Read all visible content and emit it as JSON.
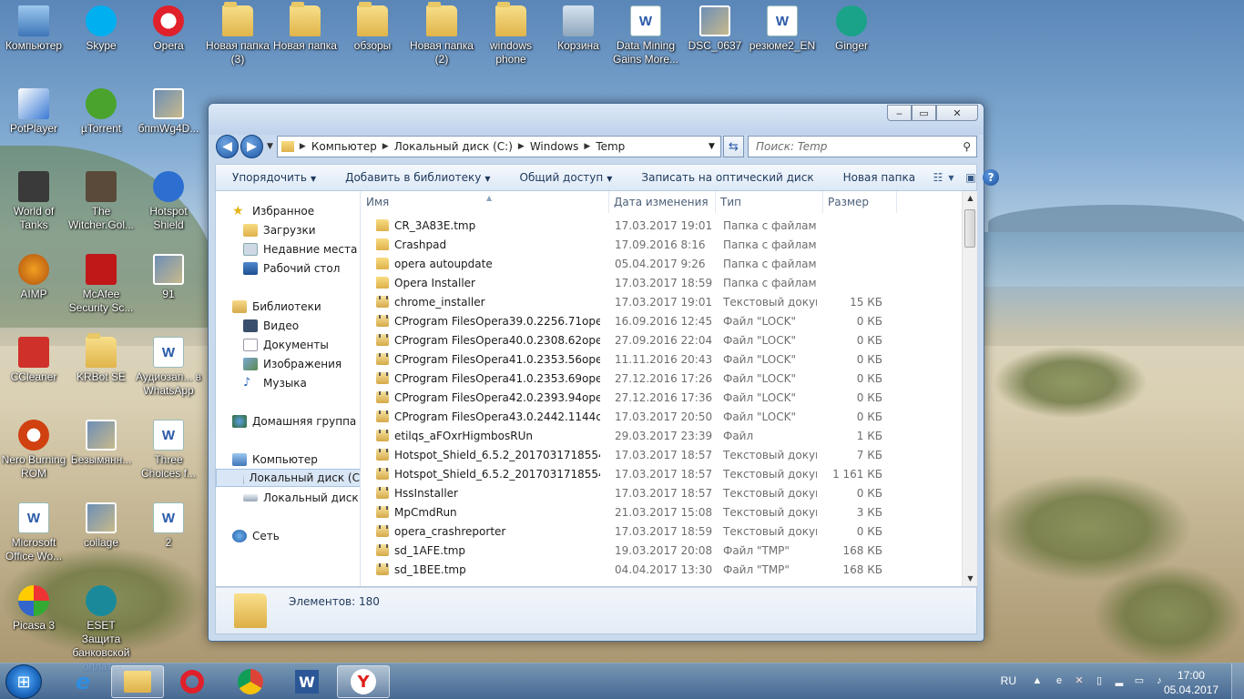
{
  "desktop": {
    "icons": [
      {
        "label": "Компьютер",
        "icon": "computer-icon"
      },
      {
        "label": "Skype",
        "icon": "skype-icon"
      },
      {
        "label": "Opera",
        "icon": "opera-icon"
      },
      {
        "label": "Новая папка (3)",
        "icon": "folder-icon"
      },
      {
        "label": "Новая папка",
        "icon": "folder-icon"
      },
      {
        "label": "обзоры",
        "icon": "folder-icon"
      },
      {
        "label": "Новая папка (2)",
        "icon": "folder-icon"
      },
      {
        "label": "windows phone",
        "icon": "folder-icon"
      },
      {
        "label": "Корзина",
        "icon": "recycle-bin-icon"
      },
      {
        "label": "Data Mining Gains More...",
        "icon": "word-doc-icon"
      },
      {
        "label": "DSC_0637",
        "icon": "image-icon"
      },
      {
        "label": "резюме2_EN",
        "icon": "word-doc-icon"
      },
      {
        "label": "Ginger",
        "icon": "ginger-icon"
      },
      {
        "label": "PotPlayer",
        "icon": "potplayer-icon"
      },
      {
        "label": "µTorrent",
        "icon": "utorrent-icon"
      },
      {
        "label": "бпmWg4D...",
        "icon": "image-icon"
      },
      {
        "label": "World of Tanks",
        "icon": "world-of-tanks-icon"
      },
      {
        "label": "The Witcher.Gol...",
        "icon": "witcher-icon"
      },
      {
        "label": "Hotspot Shield",
        "icon": "hotspot-shield-icon"
      },
      {
        "label": "AIMP",
        "icon": "aimp-icon"
      },
      {
        "label": "McAfee Security Sc...",
        "icon": "mcafee-icon"
      },
      {
        "label": "91",
        "icon": "image-icon"
      },
      {
        "label": "CCleaner",
        "icon": "ccleaner-icon"
      },
      {
        "label": "KRBot SE",
        "icon": "folder-icon"
      },
      {
        "label": "Аудиозап... в WhatsApp",
        "icon": "word-doc-icon"
      },
      {
        "label": "Nero Burning ROM",
        "icon": "nero-icon"
      },
      {
        "label": "Безымянн...",
        "icon": "image-icon"
      },
      {
        "label": "Three Choices f...",
        "icon": "word-doc-icon"
      },
      {
        "label": "Microsoft Office Wo...",
        "icon": "word-icon"
      },
      {
        "label": "collage",
        "icon": "image-icon"
      },
      {
        "label": "2",
        "icon": "word-doc-icon"
      },
      {
        "label": "Picasa 3",
        "icon": "picasa-icon"
      },
      {
        "label": "ESET Защита банковской оплаты",
        "icon": "eset-icon"
      }
    ]
  },
  "explorer": {
    "caption": {
      "minimize": "‒",
      "maximize": "▭",
      "close": "✕"
    },
    "address": {
      "crumbs": [
        "Компьютер",
        "Локальный диск (C:)",
        "Windows",
        "Temp"
      ]
    },
    "search": {
      "placeholder": "Поиск: Temp"
    },
    "toolbar": {
      "organize": "Упорядочить",
      "add_to_library": "Добавить в библиотеку",
      "share": "Общий доступ",
      "burn": "Записать на оптический диск",
      "new_folder": "Новая папка"
    },
    "nav": {
      "favorites": "Избранное",
      "downloads": "Загрузки",
      "recent": "Недавние места",
      "desktop": "Рабочий стол",
      "libraries": "Библиотеки",
      "video": "Видео",
      "documents": "Документы",
      "images": "Изображения",
      "music": "Музыка",
      "homegroup": "Домашняя группа",
      "computer": "Компьютер",
      "local_c": "Локальный диск (C",
      "local_d": "Локальный диск (D",
      "network": "Сеть"
    },
    "columns": {
      "name": "Имя",
      "date": "Дата изменения",
      "type": "Тип",
      "size": "Размер"
    },
    "files": [
      {
        "name": "CR_3A83E.tmp",
        "date": "17.03.2017 19:01",
        "type": "Папка с файлами",
        "size": "",
        "kind": "folder"
      },
      {
        "name": "Crashpad",
        "date": "17.09.2016 8:16",
        "type": "Папка с файлами",
        "size": "",
        "kind": "folder"
      },
      {
        "name": "opera autoupdate",
        "date": "05.04.2017 9:26",
        "type": "Папка с файлами",
        "size": "",
        "kind": "folder"
      },
      {
        "name": "Opera Installer",
        "date": "17.03.2017 18:59",
        "type": "Папка с файлами",
        "size": "",
        "kind": "folder"
      },
      {
        "name": "chrome_installer",
        "date": "17.03.2017 19:01",
        "type": "Текстовый докум...",
        "size": "15 КБ",
        "kind": "lock"
      },
      {
        "name": "CProgram FilesOpera39.0.2256.71opera_a...",
        "date": "16.09.2016 12:45",
        "type": "Файл \"LOCK\"",
        "size": "0 КБ",
        "kind": "lock"
      },
      {
        "name": "CProgram FilesOpera40.0.2308.62opera_a...",
        "date": "27.09.2016 22:04",
        "type": "Файл \"LOCK\"",
        "size": "0 КБ",
        "kind": "lock"
      },
      {
        "name": "CProgram FilesOpera41.0.2353.56opera_a...",
        "date": "11.11.2016 20:43",
        "type": "Файл \"LOCK\"",
        "size": "0 КБ",
        "kind": "lock"
      },
      {
        "name": "CProgram FilesOpera41.0.2353.69opera_a...",
        "date": "27.12.2016 17:26",
        "type": "Файл \"LOCK\"",
        "size": "0 КБ",
        "kind": "lock"
      },
      {
        "name": "CProgram FilesOpera42.0.2393.94opera_a...",
        "date": "27.12.2016 17:36",
        "type": "Файл \"LOCK\"",
        "size": "0 КБ",
        "kind": "lock"
      },
      {
        "name": "CProgram FilesOpera43.0.2442.1144opera...",
        "date": "17.03.2017 20:50",
        "type": "Файл \"LOCK\"",
        "size": "0 КБ",
        "kind": "lock"
      },
      {
        "name": "etilqs_aFOxrHigmbosRUn",
        "date": "29.03.2017 23:39",
        "type": "Файл",
        "size": "1 КБ",
        "kind": "lock"
      },
      {
        "name": "Hotspot_Shield_6.5.2_20170317185543",
        "date": "17.03.2017 18:57",
        "type": "Текстовый докум...",
        "size": "7 КБ",
        "kind": "lock"
      },
      {
        "name": "Hotspot_Shield_6.5.2_20170317185543_00...",
        "date": "17.03.2017 18:57",
        "type": "Текстовый докум...",
        "size": "1 161 КБ",
        "kind": "lock"
      },
      {
        "name": "HssInstaller",
        "date": "17.03.2017 18:57",
        "type": "Текстовый докум...",
        "size": "0 КБ",
        "kind": "lock"
      },
      {
        "name": "MpCmdRun",
        "date": "21.03.2017 15:08",
        "type": "Текстовый докум...",
        "size": "3 КБ",
        "kind": "lock"
      },
      {
        "name": "opera_crashreporter",
        "date": "17.03.2017 18:59",
        "type": "Текстовый докум...",
        "size": "0 КБ",
        "kind": "lock"
      },
      {
        "name": "sd_1AFE.tmp",
        "date": "19.03.2017 20:08",
        "type": "Файл \"TMP\"",
        "size": "168 КБ",
        "kind": "lock"
      },
      {
        "name": "sd_1BEE.tmp",
        "date": "04.04.2017 13:30",
        "type": "Файл \"TMP\"",
        "size": "168 КБ",
        "kind": "lock"
      }
    ],
    "status": {
      "count": "Элементов: 180"
    }
  },
  "taskbar": {
    "apps": [
      "start-button",
      "internet-explorer",
      "explorer",
      "opera",
      "chrome",
      "word",
      "yandex"
    ],
    "lang": "RU",
    "time": "17:00",
    "date": "05.04.2017"
  },
  "colors": {
    "accent": "#1f5aa8",
    "selection": "#d9e6f5"
  }
}
